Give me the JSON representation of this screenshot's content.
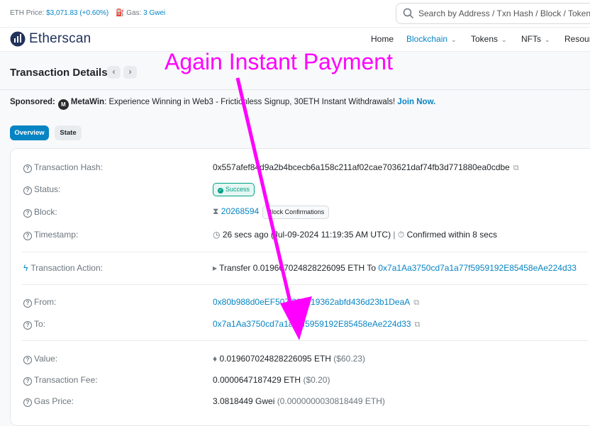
{
  "topbar": {
    "eth_price_label": "ETH Price:",
    "eth_price_value": "$3,071.83 (+0.60%)",
    "gas_label": "Gas:",
    "gas_value": "3 Gwei",
    "search_placeholder": "Search by Address / Txn Hash / Block / Token",
    "icons": [
      "search-icon",
      "gas-pump-icon"
    ]
  },
  "navbar": {
    "logo": "Etherscan",
    "items": [
      {
        "label": "Home"
      },
      {
        "label": "Blockchain"
      },
      {
        "label": "Tokens"
      },
      {
        "label": "NFTs"
      },
      {
        "label": "Resour"
      }
    ]
  },
  "page": {
    "title": "Transaction Details",
    "prev": "‹",
    "next": "›"
  },
  "sponsored": {
    "label": "Sponsored:",
    "brand": "MetaWin",
    "brand_icon_text": "M",
    "text": ": Experience Winning in Web3 - Frictionless Signup, 30ETH Instant Withdrawals!",
    "cta": "Join Now."
  },
  "tabs": [
    "Overview",
    "State"
  ],
  "details": {
    "hash_label": "Transaction Hash:",
    "hash_value": "0x557afef84d9a2b4bcecb6a158c211af02cae703621daf74fb3d771880ea0cdbe",
    "status_label": "Status:",
    "status_value": "Success",
    "block_label": "Block:",
    "block_value": "20268594",
    "block_confirmations": "Block Confirmations",
    "timestamp_label": "Timestamp:",
    "timestamp_value": "26 secs ago (Jul-09-2024 11:19:35 AM UTC)",
    "timestamp_sep": "|",
    "timestamp_confirmed": "Confirmed within 8 secs",
    "action_label": "Transaction Action:",
    "action_prefix": "Transfer",
    "action_amount": "0.019607024828226095 ETH",
    "action_to": "To",
    "action_address": "0x7a1Aa3750cd7a1a77f5959192E85458eAe224d33",
    "from_label": "From:",
    "from_value": "0x80b988d0eEF507f289219362abfd436d23b1DeaA",
    "to_label": "To:",
    "to_value": "0x7a1Aa3750cd7a1a77f5959192E85458eAe224d33",
    "value_label": "Value:",
    "value_eth": "0.019607024828226095 ETH",
    "value_usd": "($60.23)",
    "fee_label": "Transaction Fee:",
    "fee_eth": "0.0000647187429 ETH",
    "fee_usd": "($0.20)",
    "gas_price_label": "Gas Price:",
    "gas_price_gwei": "3.0818449 Gwei",
    "gas_price_eth": "(0.0000000030818449 ETH)"
  },
  "annotation": {
    "text": "Again Instant Payment",
    "color": "#ff00ff"
  },
  "colors": {
    "link": "#0784c3",
    "success": "#00a186",
    "brand_dark": "#21325b"
  }
}
